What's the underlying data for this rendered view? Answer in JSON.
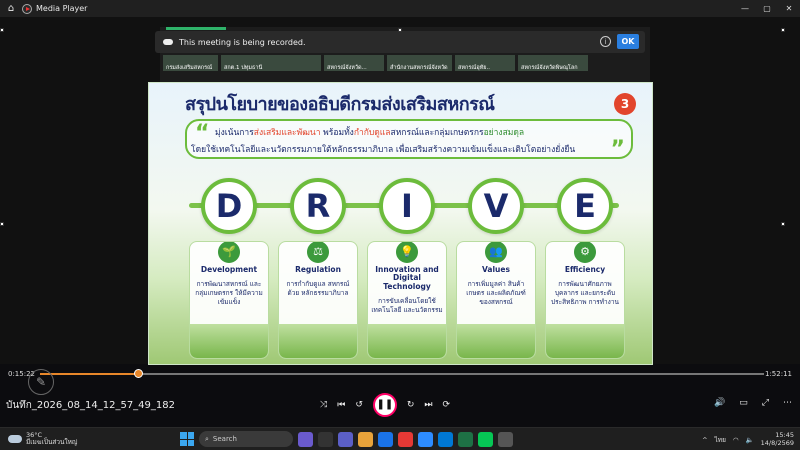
{
  "window": {
    "title": "Media Player",
    "minimize": "—",
    "restore": "▢",
    "close": "✕"
  },
  "meeting": {
    "banner_text": "This meeting is being recorded.",
    "ok_label": "OK",
    "participants": [
      "กรมส่งเสริมสหกรณ์",
      "สกต.1 ปทุมธานี",
      "สหกรณ์จังหวัด...",
      "สำนักงานสหกรณ์จังหวัด",
      "สหกรณ์อุทัย..",
      "สหกรณ์จังหวัดพิษณุโลก"
    ]
  },
  "slide": {
    "title": "สรุปนโยบายของอธิบดีกรมส่งเสริมสหกรณ์",
    "badge": "3",
    "quote_line1_a": "มุ่งเน้นการ",
    "quote_line1_b": "ส่งเสริมและพัฒนา",
    "quote_line1_c": " พร้อมทั้ง",
    "quote_line1_d": "กำกับดูแล",
    "quote_line1_e": "สหกรณ์และกลุ่มเกษตรกร",
    "quote_line1_f": "อย่างสมดุล",
    "quote_line2": "โดยใช้เทคโนโลยีและนวัตกรรมภายใต้หลักธรรมาภิบาล เพื่อเสริมสร้างความเข้มแข็งและเติบโตอย่างยั่งยืน",
    "letters": [
      "D",
      "R",
      "I",
      "V",
      "E"
    ],
    "cards": [
      {
        "title": "Development",
        "desc": "การพัฒนาสหกรณ์ และกลุ่มเกษตรกร ให้มีความเข้มแข็ง",
        "icon": "🌱"
      },
      {
        "title": "Regulation",
        "desc": "การกำกับดูแล สหกรณ์ด้วย หลักธรรมาภิบาล",
        "icon": "⚖"
      },
      {
        "title": "Innovation and Digital Technology",
        "desc": "การขับเคลื่อนโดยใช้ เทคโนโลยี และนวัตกรรม",
        "icon": "💡"
      },
      {
        "title": "Values",
        "desc": "การเพิ่มมูลค่า สินค้าเกษตร และผลิตภัณฑ์ ของสหกรณ์",
        "icon": "👥"
      },
      {
        "title": "Efficiency",
        "desc": "การพัฒนาศักยภาพ บุคลากร และยกระดับ ประสิทธิภาพ การทำงาน",
        "icon": "⚙"
      }
    ]
  },
  "player": {
    "current_time": "0:15:22",
    "total_time": "1:52:11",
    "progress": 0.137,
    "file_name": "บันทึก_2026_08_14_12_57_49_182",
    "play_icon": "❚❚"
  },
  "taskbar": {
    "temperature": "36°C",
    "weather_text": "มีเมฆเป็นส่วนใหญ่",
    "search_placeholder": "Search",
    "language": "ไทย",
    "time": "15:45",
    "date": "14/8/2569"
  }
}
